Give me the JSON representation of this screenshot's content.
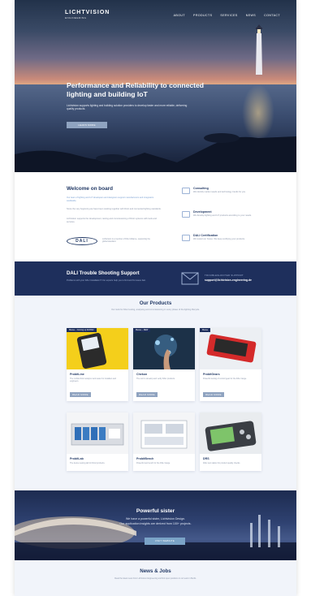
{
  "brand": {
    "name": "LICHTVISION",
    "tagline": "ENGINEERING"
  },
  "nav": [
    "ABOUT",
    "PRODUCTS",
    "SERVICES",
    "NEWS",
    "CONTACT"
  ],
  "hero": {
    "title": "Performance and Reliability to connected lighting and building IoT",
    "text": "Lichtvision supports lighting and building solution providers to develop faster and more reliable, delivering quality products.",
    "button": "LEARN MORE"
  },
  "welcome": {
    "title": "Welcome on board",
    "text1": "Our team of lighting and IoT developers and designers support manufacturers and integrators worldwide.",
    "text2": "Since the very beginning we have been working together with DALI and connected lighting standards.",
    "text3": "Lichtvision supports the development, testing and commissioning of DALI systems with tools and services.",
    "dali_logo": "DALI",
    "dali_note": "Lichtvision is a member of DALI Alliance, supporting the global standard."
  },
  "features": [
    {
      "title": "Consulting",
      "desc": "We identify market needs and technology trends for you."
    },
    {
      "title": "Development",
      "desc": "We develop lighting and IoT products according to your needs."
    },
    {
      "title": "DALI Certification",
      "desc": "We tested our house. We keep certifying your products."
    }
  ],
  "dali_support": {
    "title": "DALI Trouble Shooting Support",
    "text": "Problems with your DALI installation? Our experts help you to find and fix issues fast.",
    "support_title": "TROUBLESHOOTER SUPPORT",
    "email": "support@lichtvision-engineering.de"
  },
  "products": {
    "title": "Our Products",
    "subtitle": "Our tools for DALI testing, analysing and commissioning in every phase of the lighting lifecycle.",
    "items": [
      {
        "tag": "Messe – Coming up 02/2022",
        "name": "ProbitLine",
        "desc": "The mobile DALI analyzer and tester for installers and engineers.",
        "button": "READ MORE"
      },
      {
        "tag": "Messe – NEW",
        "name": "Chekon",
        "desc": "The tool to develop and verify DALI products.",
        "button": "READ MORE"
      },
      {
        "tag": "Messe",
        "name": "ProbitGears",
        "desc": "Powerful testing of control gear for the DALI range.",
        "button": "READ MORE"
      },
      {
        "tag": "",
        "name": "ProbitLab",
        "desc": "The device testing lab for DALI products.",
        "button": ""
      },
      {
        "tag": "",
        "name": "ProbitBench",
        "desc": "Powerful test bench for the DALI range.",
        "button": ""
      },
      {
        "tag": "",
        "name": "DRS",
        "desc": "DALI test station for product quality checks.",
        "button": ""
      }
    ]
  },
  "sister": {
    "title": "Powerful sister",
    "line1": "We have a powerful sister, Lichtvision Design.",
    "line2": "Our application insights are derived from 100+ projects.",
    "button": "VISIT WEBSITE"
  },
  "news": {
    "title": "News & Jobs",
    "text": "Read the latest news from Lichtvision Engineering and find open positions in our team in Berlin."
  },
  "colors": {
    "navy": "#1e2f5c",
    "accent": "#8fa3c0",
    "background": "#f1f4fa"
  }
}
